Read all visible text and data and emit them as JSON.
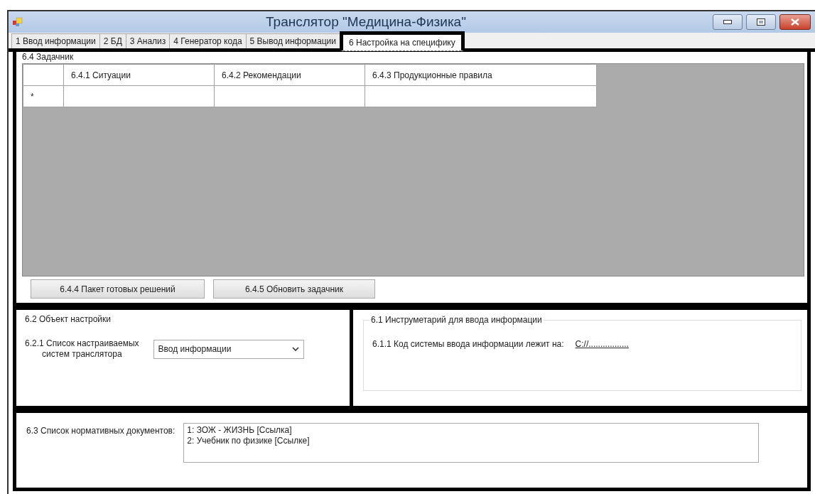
{
  "window": {
    "title": "Транслятор \"Медицина-Физика\""
  },
  "tabs": [
    {
      "label": "1 Ввод информации",
      "selected": false
    },
    {
      "label": "2 БД",
      "selected": false
    },
    {
      "label": "3 Анализ",
      "selected": false
    },
    {
      "label": "4 Генератор кода",
      "selected": false
    },
    {
      "label": "5 Вывод информации",
      "selected": false
    },
    {
      "label": "6 Настройка на специфику",
      "selected": true
    }
  ],
  "task_section": {
    "title": "6.4 Задачник",
    "grid": {
      "columns": [
        "6.4.1 Ситуации",
        "6.4.2 Рекомендации",
        "6.4.3 Продукционные правила"
      ],
      "new_row_marker": "*"
    },
    "buttons": [
      "6.4.4 Пакет готовых решений",
      "6.4.5 Обновить задачник"
    ]
  },
  "settings_object": {
    "title": "6.2 Объект настройки",
    "label_lines": [
      "6.2.1 Список настраиваемых",
      "систем транслятора"
    ],
    "dropdown_value": "Ввод информации"
  },
  "tools": {
    "title": "6.1 Инструметарий для ввода информации",
    "label": "6.1.1 Код системы ввода информации лежит на:",
    "link": "C://................."
  },
  "documents": {
    "label": "6.3 Список нормативных документов:",
    "items": [
      "1: ЗОЖ - ЖИЗНЬ [Ссылка]",
      "2: Учебник по физике [Ссылке]"
    ]
  }
}
